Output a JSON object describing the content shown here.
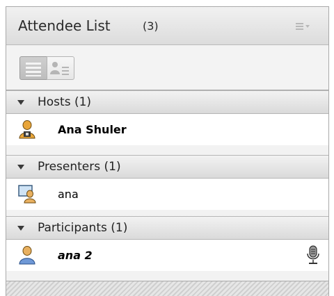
{
  "header": {
    "title": "Attendee List",
    "count": "(3)",
    "menu_icon": "pod-menu-icon"
  },
  "toolbar": {
    "list_view_icon": "list-view-icon",
    "card_view_icon": "card-view-icon"
  },
  "sections": [
    {
      "label": "Hosts (1)",
      "attendees": [
        {
          "name": "Ana Shuler",
          "role_icon": "host-icon"
        }
      ]
    },
    {
      "label": "Presenters (1)",
      "attendees": [
        {
          "name": "ana",
          "role_icon": "presenter-icon"
        }
      ]
    },
    {
      "label": "Participants (1)",
      "attendees": [
        {
          "name": "ana 2",
          "role_icon": "participant-icon",
          "status_icon": "microphone-icon"
        }
      ]
    }
  ]
}
